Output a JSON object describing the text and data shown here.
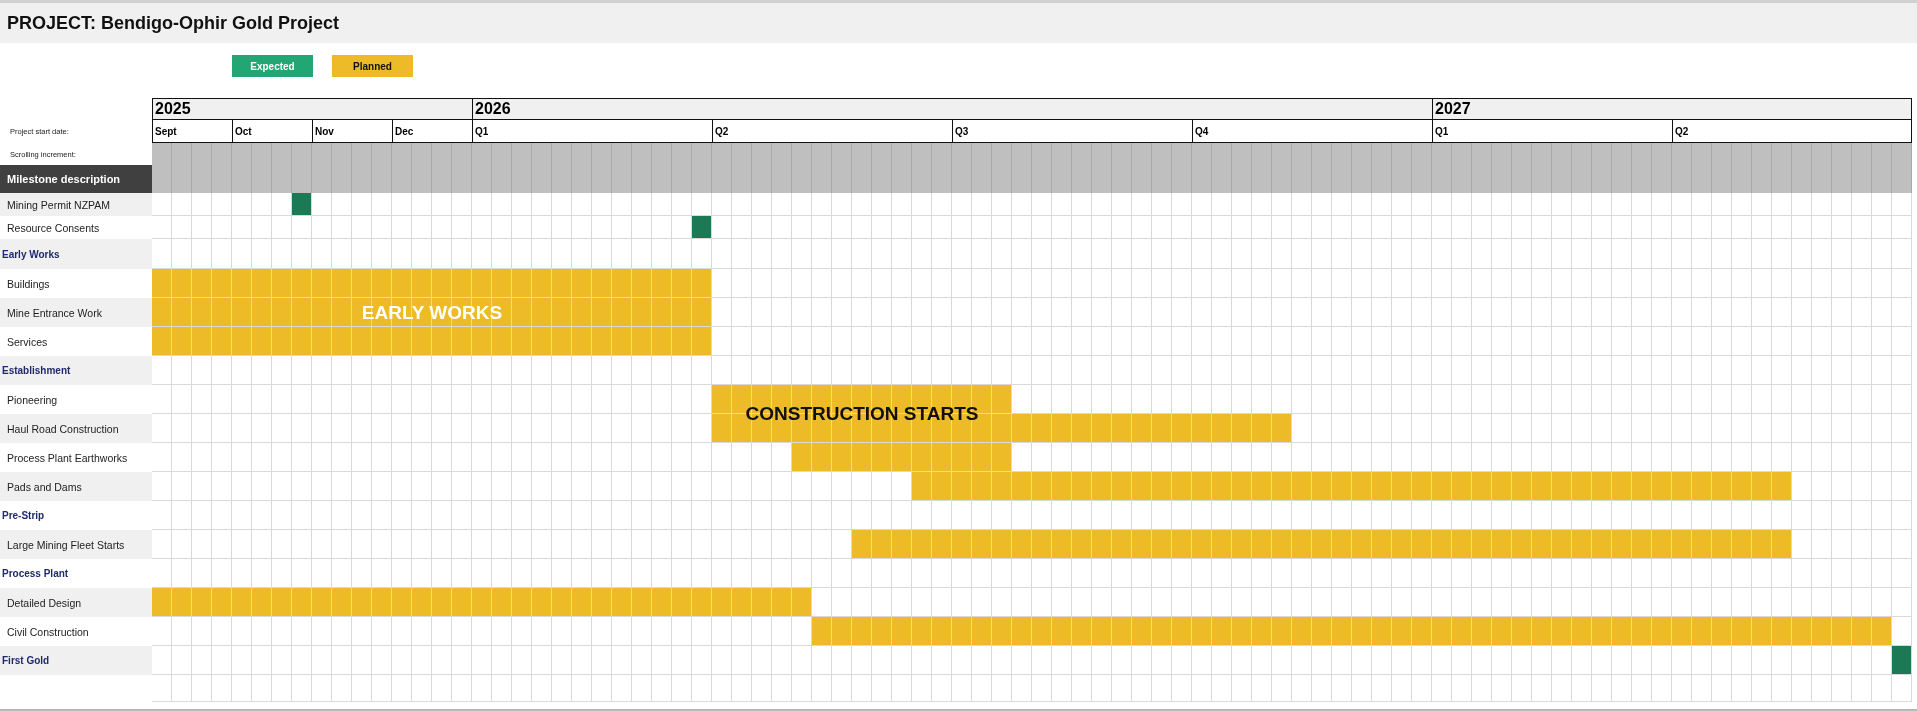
{
  "title": "PROJECT: Bendigo-Ophir Gold Project",
  "legend": [
    {
      "label": "Expected",
      "kind": "expected"
    },
    {
      "label": "Planned",
      "kind": "planned"
    }
  ],
  "side_labels": {
    "start_date": "Project start date:",
    "scrolling": "Scrolling increment:",
    "header": "Milestone description"
  },
  "years": [
    {
      "label": "2025",
      "periods": [
        {
          "label": "Sept",
          "kind": "month"
        },
        {
          "label": "Oct",
          "kind": "month"
        },
        {
          "label": "Nov",
          "kind": "month"
        },
        {
          "label": "Dec",
          "kind": "month"
        }
      ]
    },
    {
      "label": "2026",
      "periods": [
        {
          "label": "Q1",
          "kind": "quarter"
        },
        {
          "label": "Q2",
          "kind": "quarter"
        },
        {
          "label": "Q3",
          "kind": "quarter"
        },
        {
          "label": "Q4",
          "kind": "quarter"
        }
      ]
    },
    {
      "label": "2027",
      "periods": [
        {
          "label": "Q1",
          "kind": "quarter"
        },
        {
          "label": "Q2",
          "kind": "quarter"
        }
      ]
    }
  ],
  "rows": [
    {
      "label": "Mining Permit NZPAM",
      "kind": "milestone",
      "weeks": [
        false,
        false,
        false,
        false,
        false,
        false,
        false,
        true,
        false,
        false,
        false,
        false,
        false,
        false,
        false,
        false,
        false,
        false,
        false,
        false,
        false,
        false,
        false,
        false,
        false,
        false,
        false,
        false,
        false,
        false,
        false,
        false,
        false,
        false,
        false,
        false,
        false,
        false,
        false,
        false,
        false,
        false,
        false,
        false,
        false,
        false,
        false,
        false,
        false,
        false,
        false,
        false,
        false,
        false,
        false,
        false,
        false,
        false,
        false,
        false,
        false,
        false,
        false,
        false,
        false,
        false,
        false,
        false,
        false,
        false,
        false,
        false,
        false,
        false,
        false,
        false,
        false,
        false,
        false,
        false,
        false,
        false,
        false,
        false,
        false,
        false,
        false,
        false
      ]
    },
    {
      "label": "Resource Consents",
      "kind": "milestone",
      "weeks": [
        false,
        false,
        false,
        false,
        false,
        false,
        false,
        false,
        false,
        false,
        false,
        false,
        false,
        false,
        false,
        false,
        false,
        false,
        false,
        false,
        false,
        false,
        false,
        false,
        false,
        false,
        false,
        true,
        false,
        false,
        false,
        false,
        false,
        false,
        false,
        false,
        false,
        false,
        false,
        false,
        false,
        false,
        false,
        false,
        false,
        false,
        false,
        false,
        false,
        false,
        false,
        false,
        false,
        false,
        false,
        false,
        false,
        false,
        false,
        false,
        false,
        false,
        false,
        false,
        false,
        false,
        false,
        false,
        false,
        false,
        false,
        false,
        false,
        false,
        false,
        false,
        false,
        false,
        false,
        false,
        false,
        false,
        false,
        false,
        false,
        false,
        false,
        false
      ]
    },
    {
      "label": "Early Works",
      "kind": "section"
    },
    {
      "label": "Buildings",
      "kind": "task",
      "weeks": [
        true,
        true,
        true,
        true,
        true,
        true,
        true,
        true,
        true,
        true,
        true,
        true,
        true,
        true,
        true,
        true,
        true,
        true,
        true,
        true,
        true,
        true,
        true,
        true,
        true,
        true,
        true,
        true,
        false,
        false,
        false,
        false,
        false,
        false,
        false,
        false,
        false,
        false,
        false,
        false,
        false,
        false,
        false,
        false,
        false,
        false,
        false,
        false,
        false,
        false,
        false,
        false,
        false,
        false,
        false,
        false,
        false,
        false,
        false,
        false,
        false,
        false,
        false,
        false,
        false,
        false,
        false,
        false,
        false,
        false,
        false,
        false,
        false,
        false,
        false,
        false,
        false,
        false,
        false,
        false,
        false,
        false,
        false,
        false,
        false,
        false,
        false,
        false
      ]
    },
    {
      "label": "Mine Entrance Work",
      "kind": "task",
      "weeks": [
        true,
        true,
        true,
        true,
        true,
        true,
        true,
        true,
        true,
        true,
        true,
        true,
        true,
        true,
        true,
        true,
        true,
        true,
        true,
        true,
        true,
        true,
        true,
        true,
        true,
        true,
        true,
        true,
        false,
        false,
        false,
        false,
        false,
        false,
        false,
        false,
        false,
        false,
        false,
        false,
        false,
        false,
        false,
        false,
        false,
        false,
        false,
        false,
        false,
        false,
        false,
        false,
        false,
        false,
        false,
        false,
        false,
        false,
        false,
        false,
        false,
        false,
        false,
        false,
        false,
        false,
        false,
        false,
        false,
        false,
        false,
        false,
        false,
        false,
        false,
        false,
        false,
        false,
        false,
        false,
        false,
        false,
        false,
        false,
        false,
        false,
        false,
        false
      ],
      "overlay": {
        "text": "EARLY WORKS",
        "kind": "inset"
      }
    },
    {
      "label": "Services",
      "kind": "task",
      "weeks": [
        true,
        true,
        true,
        true,
        true,
        true,
        true,
        true,
        true,
        true,
        true,
        true,
        true,
        true,
        true,
        true,
        true,
        true,
        true,
        true,
        true,
        true,
        true,
        true,
        true,
        true,
        true,
        true,
        false,
        false,
        false,
        false,
        false,
        false,
        false,
        false,
        false,
        false,
        false,
        false,
        false,
        false,
        false,
        false,
        false,
        false,
        false,
        false,
        false,
        false,
        false,
        false,
        false,
        false,
        false,
        false,
        false,
        false,
        false,
        false,
        false,
        false,
        false,
        false,
        false,
        false,
        false,
        false,
        false,
        false,
        false,
        false,
        false,
        false,
        false,
        false,
        false,
        false,
        false,
        false,
        false,
        false,
        false,
        false,
        false,
        false,
        false,
        false
      ]
    },
    {
      "label": "Establishment",
      "kind": "section"
    },
    {
      "label": "Pioneering",
      "kind": "task",
      "weeks": [
        false,
        false,
        false,
        false,
        false,
        false,
        false,
        false,
        false,
        false,
        false,
        false,
        false,
        false,
        false,
        false,
        false,
        false,
        false,
        false,
        false,
        false,
        false,
        false,
        false,
        false,
        false,
        false,
        true,
        true,
        true,
        true,
        true,
        true,
        true,
        true,
        true,
        true,
        true,
        true,
        true,
        true,
        true,
        false,
        false,
        false,
        false,
        false,
        false,
        false,
        false,
        false,
        false,
        false,
        false,
        false,
        false,
        false,
        false,
        false,
        false,
        false,
        false,
        false,
        false,
        false,
        false,
        false,
        false,
        false,
        false,
        false,
        false,
        false,
        false,
        false,
        false,
        false,
        false,
        false,
        false,
        false,
        false,
        false,
        false,
        false,
        false,
        false
      ],
      "overlay": {
        "text": "CONSTRUCTION STARTS",
        "kind": "straddle"
      }
    },
    {
      "label": "Haul Road Construction",
      "kind": "task",
      "weeks": [
        false,
        false,
        false,
        false,
        false,
        false,
        false,
        false,
        false,
        false,
        false,
        false,
        false,
        false,
        false,
        false,
        false,
        false,
        false,
        false,
        false,
        false,
        false,
        false,
        false,
        false,
        false,
        false,
        true,
        true,
        true,
        true,
        true,
        true,
        true,
        true,
        true,
        true,
        true,
        true,
        true,
        true,
        true,
        true,
        true,
        true,
        true,
        true,
        true,
        true,
        true,
        true,
        true,
        true,
        true,
        true,
        true,
        false,
        false,
        false,
        false,
        false,
        false,
        false,
        false,
        false,
        false,
        false,
        false,
        false,
        false,
        false,
        false,
        false,
        false,
        false,
        false,
        false,
        false,
        false,
        false,
        false,
        false,
        false,
        false,
        false,
        false,
        false
      ]
    },
    {
      "label": "Process Plant Earthworks",
      "kind": "task",
      "weeks": [
        false,
        false,
        false,
        false,
        false,
        false,
        false,
        false,
        false,
        false,
        false,
        false,
        false,
        false,
        false,
        false,
        false,
        false,
        false,
        false,
        false,
        false,
        false,
        false,
        false,
        false,
        false,
        false,
        false,
        false,
        false,
        false,
        true,
        true,
        true,
        true,
        true,
        true,
        true,
        true,
        true,
        true,
        true,
        false,
        false,
        false,
        false,
        false,
        false,
        false,
        false,
        false,
        false,
        false,
        false,
        false,
        false,
        false,
        false,
        false,
        false,
        false,
        false,
        false,
        false,
        false,
        false,
        false,
        false,
        false,
        false,
        false,
        false,
        false,
        false,
        false,
        false,
        false,
        false,
        false,
        false,
        false,
        false,
        false,
        false,
        false,
        false,
        false
      ]
    },
    {
      "label": "Pads and Dams",
      "kind": "task",
      "weeks": [
        false,
        false,
        false,
        false,
        false,
        false,
        false,
        false,
        false,
        false,
        false,
        false,
        false,
        false,
        false,
        false,
        false,
        false,
        false,
        false,
        false,
        false,
        false,
        false,
        false,
        false,
        false,
        false,
        false,
        false,
        false,
        false,
        false,
        false,
        false,
        false,
        false,
        false,
        true,
        true,
        true,
        true,
        true,
        true,
        true,
        true,
        true,
        true,
        true,
        true,
        true,
        true,
        true,
        true,
        true,
        true,
        true,
        true,
        true,
        true,
        true,
        true,
        true,
        true,
        true,
        true,
        true,
        true,
        true,
        true,
        true,
        true,
        true,
        true,
        true,
        true,
        true,
        true,
        true,
        true,
        true,
        true,
        false,
        false,
        false,
        false,
        false,
        false
      ]
    },
    {
      "label": "Pre-Strip",
      "kind": "section"
    },
    {
      "label": "Large Mining Fleet Starts",
      "kind": "task",
      "weeks": [
        false,
        false,
        false,
        false,
        false,
        false,
        false,
        false,
        false,
        false,
        false,
        false,
        false,
        false,
        false,
        false,
        false,
        false,
        false,
        false,
        false,
        false,
        false,
        false,
        false,
        false,
        false,
        false,
        false,
        false,
        false,
        false,
        false,
        false,
        false,
        true,
        true,
        true,
        true,
        true,
        true,
        true,
        true,
        true,
        true,
        true,
        true,
        true,
        true,
        true,
        true,
        true,
        true,
        true,
        true,
        true,
        true,
        true,
        true,
        true,
        true,
        true,
        true,
        true,
        true,
        true,
        true,
        true,
        true,
        true,
        true,
        true,
        true,
        true,
        true,
        true,
        true,
        true,
        true,
        true,
        true,
        true,
        false,
        false,
        false,
        false,
        false,
        false
      ]
    },
    {
      "label": "Process Plant",
      "kind": "section"
    },
    {
      "label": "Detailed Design",
      "kind": "task",
      "weeks": [
        true,
        true,
        true,
        true,
        true,
        true,
        true,
        true,
        true,
        true,
        true,
        true,
        true,
        true,
        true,
        true,
        true,
        true,
        true,
        true,
        true,
        true,
        true,
        true,
        true,
        true,
        true,
        true,
        true,
        true,
        true,
        true,
        true,
        false,
        false,
        false,
        false,
        false,
        false,
        false,
        false,
        false,
        false,
        false,
        false,
        false,
        false,
        false,
        false,
        false,
        false,
        false,
        false,
        false,
        false,
        false,
        false,
        false,
        false,
        false,
        false,
        false,
        false,
        false,
        false,
        false,
        false,
        false,
        false,
        false,
        false,
        false,
        false,
        false,
        false,
        false,
        false,
        false,
        false,
        false,
        false,
        false,
        false,
        false,
        false,
        false,
        false,
        false
      ]
    },
    {
      "label": "Civil Construction",
      "kind": "task",
      "weeks": [
        false,
        false,
        false,
        false,
        false,
        false,
        false,
        false,
        false,
        false,
        false,
        false,
        false,
        false,
        false,
        false,
        false,
        false,
        false,
        false,
        false,
        false,
        false,
        false,
        false,
        false,
        false,
        false,
        false,
        false,
        false,
        false,
        false,
        true,
        true,
        true,
        true,
        true,
        true,
        true,
        true,
        true,
        true,
        true,
        true,
        true,
        true,
        true,
        true,
        true,
        true,
        true,
        true,
        true,
        true,
        true,
        true,
        true,
        true,
        true,
        true,
        true,
        true,
        true,
        true,
        true,
        true,
        true,
        true,
        true,
        true,
        true,
        true,
        true,
        true,
        true,
        true,
        true,
        true,
        true,
        true,
        true,
        true,
        true,
        true,
        true,
        true,
        false
      ]
    },
    {
      "label": "First Gold",
      "kind": "goal",
      "weeks": [
        false,
        false,
        false,
        false,
        false,
        false,
        false,
        false,
        false,
        false,
        false,
        false,
        false,
        false,
        false,
        false,
        false,
        false,
        false,
        false,
        false,
        false,
        false,
        false,
        false,
        false,
        false,
        false,
        false,
        false,
        false,
        false,
        false,
        false,
        false,
        false,
        false,
        false,
        false,
        false,
        false,
        false,
        false,
        false,
        false,
        false,
        false,
        false,
        false,
        false,
        false,
        false,
        false,
        false,
        false,
        false,
        false,
        false,
        false,
        false,
        false,
        false,
        false,
        false,
        false,
        false,
        false,
        false,
        false,
        false,
        false,
        false,
        false,
        false,
        false,
        false,
        false,
        false,
        false,
        false,
        false,
        false,
        false,
        false,
        false,
        false,
        false,
        true
      ]
    }
  ]
}
